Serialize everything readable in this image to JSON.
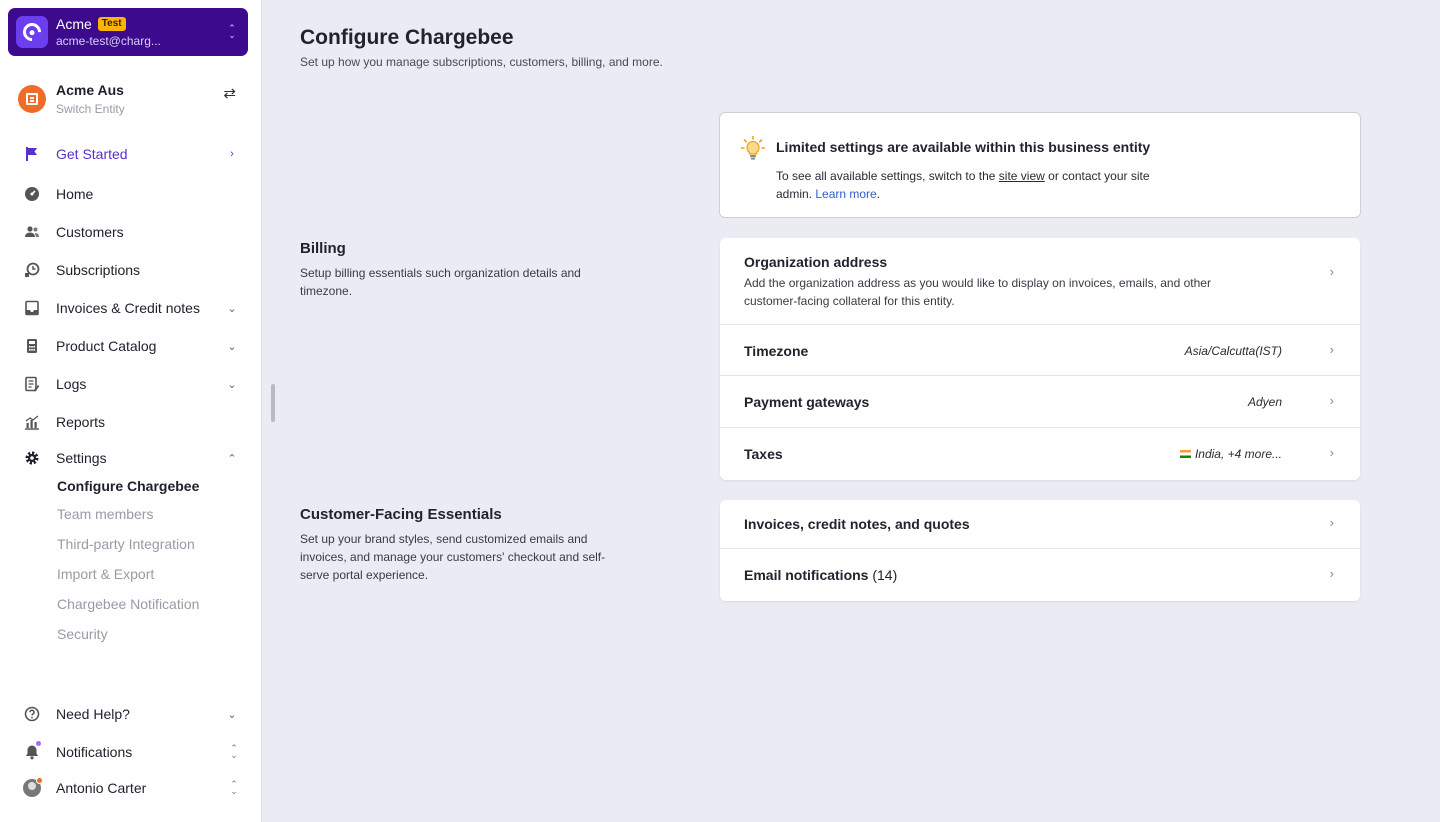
{
  "account": {
    "name": "Acme",
    "badge": "Test",
    "email": "acme-test@charg..."
  },
  "entity": {
    "name": "Acme Aus",
    "sub": "Switch Entity"
  },
  "nav": {
    "get_started": "Get Started",
    "home": "Home",
    "customers": "Customers",
    "subscriptions": "Subscriptions",
    "invoices": "Invoices & Credit notes",
    "catalog": "Product Catalog",
    "logs": "Logs",
    "reports": "Reports",
    "settings": "Settings",
    "settings_sub": [
      "Configure Chargebee",
      "Team members",
      "Third-party Integration",
      "Import & Export",
      "Chargebee Notification",
      "Security"
    ],
    "help": "Need Help?",
    "notifications": "Notifications",
    "user": "Antonio Carter"
  },
  "page": {
    "title": "Configure Chargebee",
    "subtitle": "Set up how you manage subscriptions, customers, billing, and more."
  },
  "info": {
    "title": "Limited settings are available within this business entity",
    "text1": "To see all available settings, switch to the ",
    "link1": "site view",
    "text2": " or contact your site admin. ",
    "link2": "Learn more",
    "text3": "."
  },
  "billing": {
    "title": "Billing",
    "desc": "Setup billing essentials such organization details and timezone.",
    "rows": [
      {
        "title": "Organization address",
        "desc": "Add the organization address as you would like to display on invoices, emails, and other customer-facing collateral for this entity."
      },
      {
        "title": "Timezone",
        "value": "Asia/Calcutta(IST)"
      },
      {
        "title": "Payment gateways",
        "value": "Adyen"
      },
      {
        "title": "Taxes",
        "value": "India, +4 more..."
      }
    ]
  },
  "customer": {
    "title": "Customer-Facing Essentials",
    "desc": "Set up your brand styles, send customized emails and invoices, and manage your customers' checkout and self-serve portal experience.",
    "rows": [
      {
        "title": "Invoices, credit notes, and quotes"
      },
      {
        "title": "Email notifications",
        "count": "(14)"
      }
    ]
  },
  "colors": {
    "accent": "#5a2fd0",
    "account_bg": "#3c0a8c",
    "test_badge": "#ffb400",
    "entity": "#f06a2a",
    "link": "#2f5ec7"
  }
}
